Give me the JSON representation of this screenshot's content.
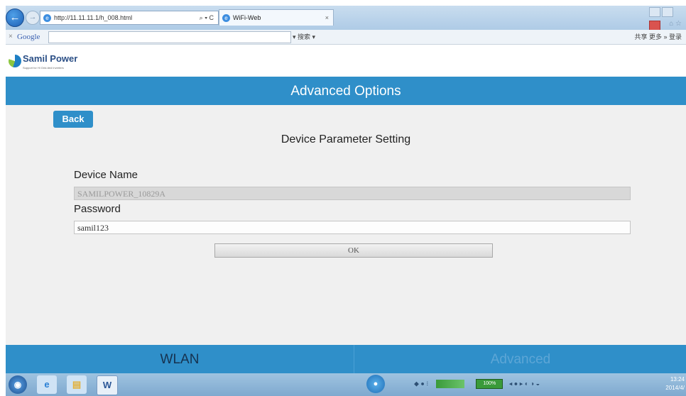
{
  "browser": {
    "address": "http://11.11.11.1/h_008.html",
    "address_tools": "⌕ ▾ C",
    "tab_title": "WiFi-Web",
    "tab_close": "×",
    "back_glyph": "←",
    "forward_glyph": "→",
    "google_close": "×",
    "google_logo": "Google",
    "google_tools": "▾  搜索 ▾",
    "google_right": "共享  更多 »   登录",
    "home_icons": "⌂ ☆"
  },
  "logo": {
    "name": "Samil Power",
    "tagline": "Support for Hi Grid-tied Inverters"
  },
  "page": {
    "header_title": "Advanced Options",
    "back_label": "Back",
    "section_title": "Device Parameter Setting",
    "device_name_label": "Device Name",
    "device_name_value": "SAMILPOWER_10829A",
    "password_label": "Password",
    "password_value": "samil123",
    "ok_label": "OK"
  },
  "footer": {
    "tabs": [
      {
        "label": "WLAN",
        "active": true
      },
      {
        "label": "Advanced",
        "active": false
      }
    ]
  },
  "taskbar": {
    "start_glyph": "◉",
    "ie_glyph": "e",
    "folder_glyph": "▤",
    "word_glyph": "W",
    "chrome_glyph": "●",
    "battery": "100%",
    "time": "13:24",
    "date": "2014/4/"
  },
  "colors": {
    "accent": "#2f8fc9",
    "footer_active_text": "#16324f",
    "footer_inactive_text": "#5da6d6"
  }
}
